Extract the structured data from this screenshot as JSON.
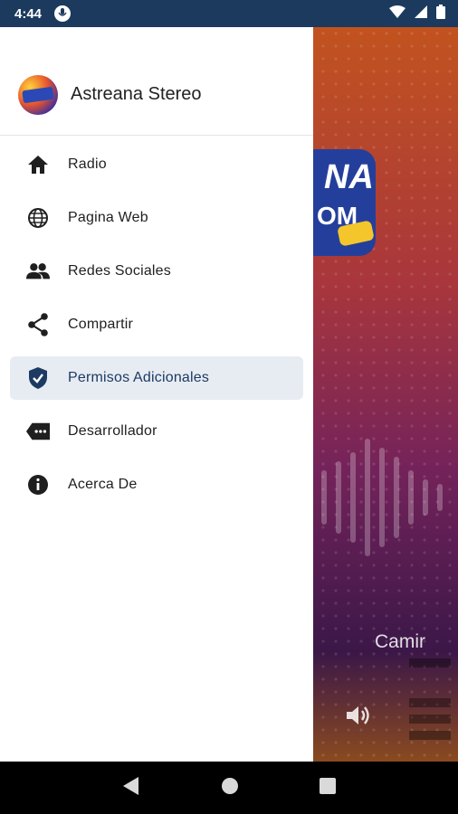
{
  "status_bar": {
    "time": "4:44"
  },
  "background": {
    "song_title": "Camir"
  },
  "drawer": {
    "app_name": "Astreana Stereo",
    "items": [
      {
        "label": "Radio",
        "icon": "home-icon",
        "active": false
      },
      {
        "label": "Pagina Web",
        "icon": "globe-icon",
        "active": false
      },
      {
        "label": "Redes Sociales",
        "icon": "people-icon",
        "active": false
      },
      {
        "label": "Compartir",
        "icon": "share-icon",
        "active": false
      },
      {
        "label": "Permisos Adicionales",
        "icon": "shield-check-icon",
        "active": true
      },
      {
        "label": "Desarrollador",
        "icon": "label-tag-icon",
        "active": false
      },
      {
        "label": "Acerca De",
        "icon": "info-icon",
        "active": false
      }
    ]
  },
  "colors": {
    "status_bar": "#1b3a5e",
    "active_item_bg": "#e7ecf3",
    "active_item_fg": "#1d3a63",
    "icon": "#1f1f1f"
  }
}
